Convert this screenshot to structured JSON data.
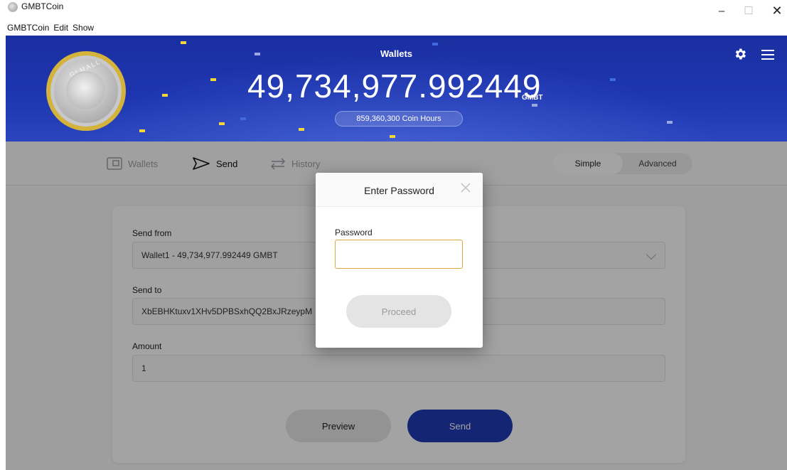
{
  "window": {
    "title": "GMBTCoin",
    "min": "–",
    "max": "☐",
    "close": "✕"
  },
  "menu": [
    "GMBTCoin",
    "Edit",
    "Show"
  ],
  "header": {
    "title": "Wallets",
    "balance": "49,734,977.992449",
    "unit": "GMBT",
    "hours": "859,360,300 Coin Hours",
    "coin_text": "GLMALL"
  },
  "nav": {
    "tabs": [
      {
        "label": "Wallets",
        "icon": "wallet-icon",
        "active": false
      },
      {
        "label": "Send",
        "icon": "send-icon",
        "active": true
      },
      {
        "label": "History",
        "icon": "history-icon",
        "active": false
      }
    ],
    "modes": [
      {
        "label": "Simple",
        "active": true
      },
      {
        "label": "Advanced",
        "active": false
      }
    ]
  },
  "form": {
    "send_from_label": "Send from",
    "send_from_value": "Wallet1 - 49,734,977.992449 GMBT",
    "send_to_label": "Send to",
    "send_to_value": "XbEBHKtuxv1XHv5DPBSxhQQ2BxJRzeypM",
    "amount_label": "Amount",
    "amount_value": "1",
    "preview_label": "Preview",
    "send_label": "Send"
  },
  "modal": {
    "title": "Enter Password",
    "password_label": "Password",
    "password_value": "",
    "proceed_label": "Proceed"
  },
  "colors": {
    "brand_blue": "#1e3bb5",
    "focus_orange": "#e0a53b",
    "coin_gold": "#d4b33a"
  }
}
